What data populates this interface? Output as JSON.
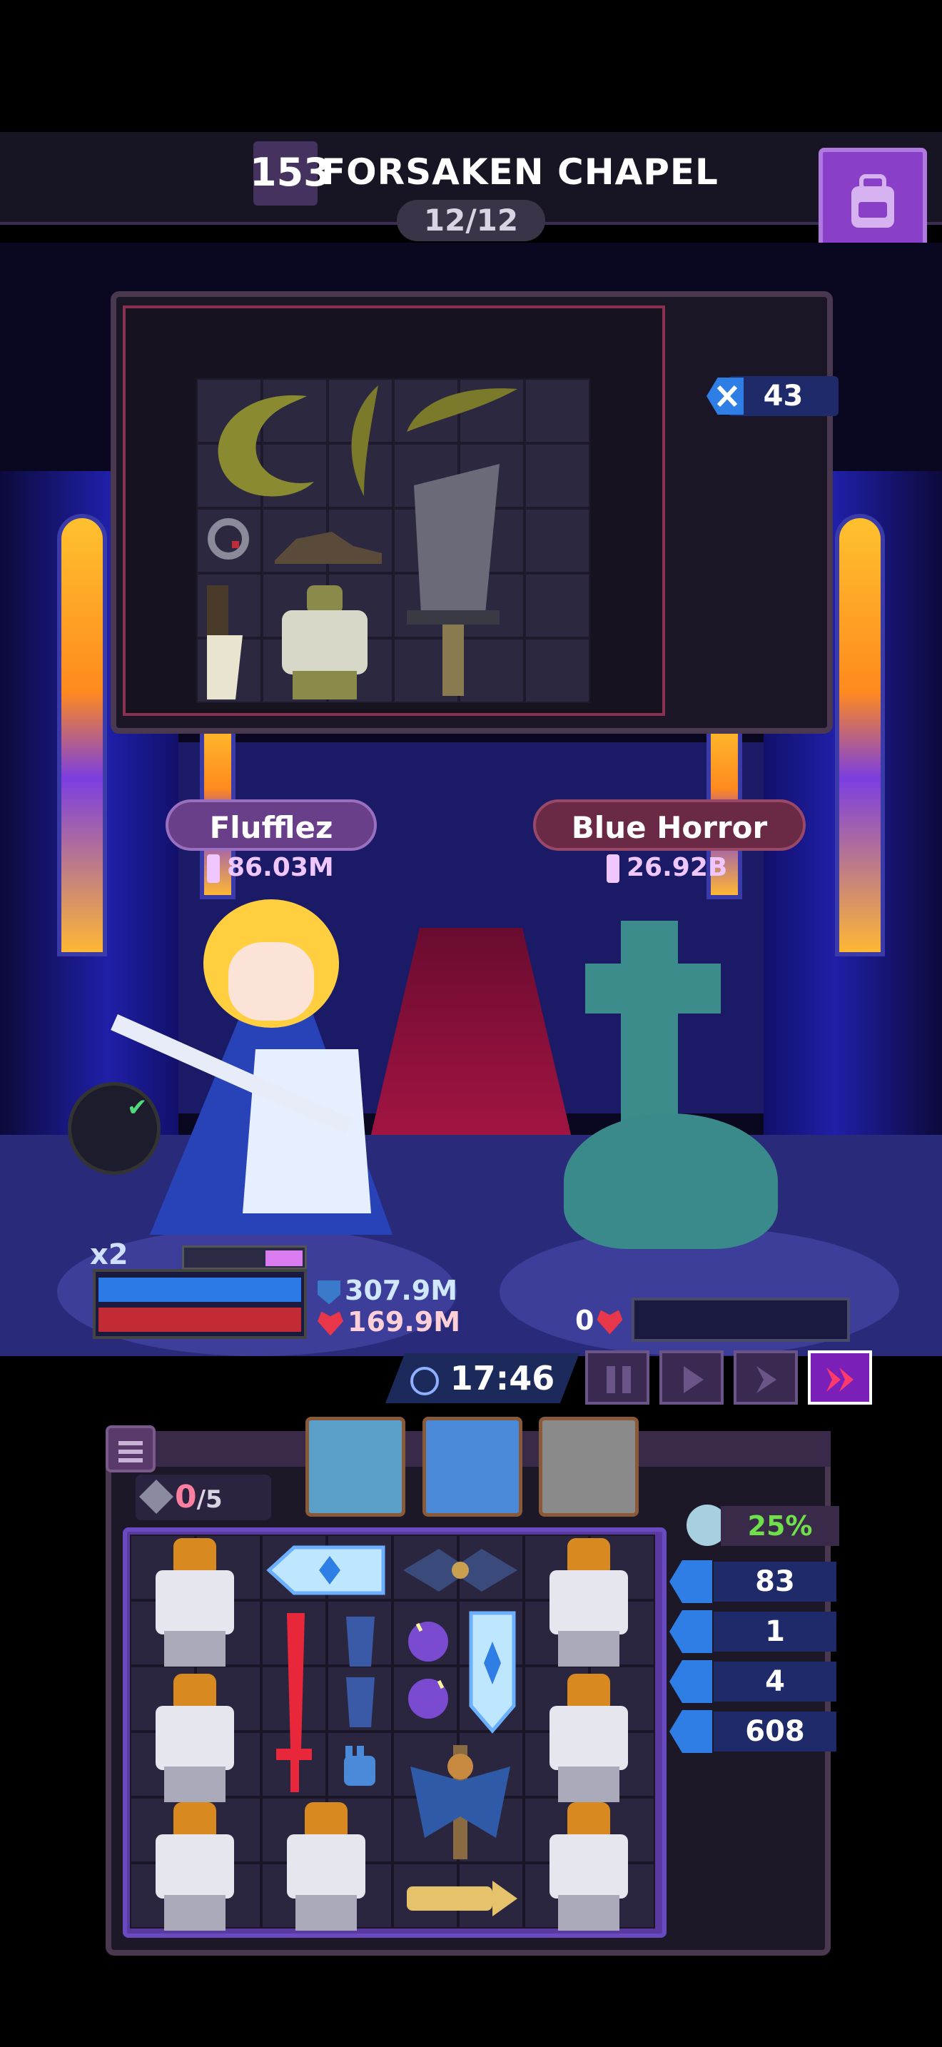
{
  "header": {
    "level_number": "153",
    "stage_title": "FORSAKEN CHAPEL",
    "wave_progress": "12/12"
  },
  "loot": {
    "kills_badge": "43"
  },
  "player": {
    "name": "Flufflez",
    "power": "86.03M",
    "multiplier": "x2",
    "shield": "307.9M",
    "life": "169.9M"
  },
  "enemy": {
    "name": "Blue Horror",
    "power": "26.92B",
    "life": "0"
  },
  "controls": {
    "timer": "17:46",
    "buttons": [
      "pause",
      "play",
      "fast-forward",
      "skip"
    ]
  },
  "inventory": {
    "gem_count": "0",
    "gem_max": "/5",
    "percent": "25%",
    "stats": [
      {
        "icon": "orb-icon",
        "value": "83"
      },
      {
        "icon": "pile-icon",
        "value": "1"
      },
      {
        "icon": "monster-icon",
        "value": "4"
      },
      {
        "icon": "skull-icon",
        "value": "608"
      }
    ]
  },
  "colors": {
    "accent_purple": "#8a3fc8",
    "stat_blue": "#2f7ee6",
    "hp_red": "#c22a36",
    "percent_green": "#6fdf4a"
  }
}
